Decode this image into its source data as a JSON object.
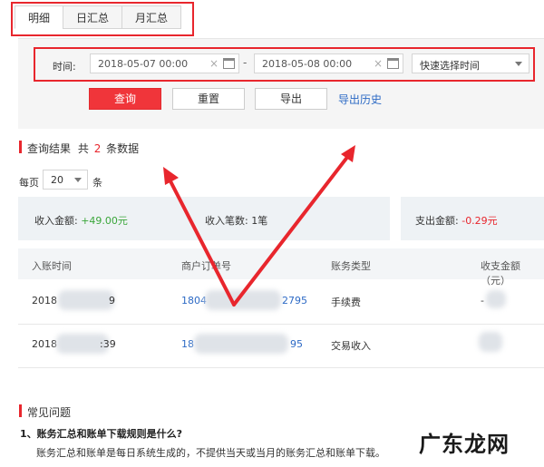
{
  "tabs": [
    "明细",
    "日汇总",
    "月汇总"
  ],
  "filter": {
    "time_label": "时间:",
    "start_date": "2018-05-07 00:00",
    "end_date": "2018-05-08 00:00",
    "range_separator": "-",
    "clear_symbol": "×",
    "quick_select": "快速选择时间"
  },
  "buttons": {
    "query": "查询",
    "reset": "重置",
    "export": "导出",
    "export_history": "导出历史"
  },
  "results": {
    "title": "查询结果",
    "prefix": "共",
    "count": "2",
    "suffix": "条数据"
  },
  "pagination": {
    "per_page_label": "每页",
    "per_page_value": "20",
    "per_page_unit": "条"
  },
  "summary": {
    "income_label": "收入金额:",
    "income_value": "+49.00元",
    "income_count_label": "收入笔数:",
    "income_count_value": "1笔",
    "expense_label": "支出金额:",
    "expense_value": "-0.29元"
  },
  "table": {
    "headers": [
      "入账时间",
      "商户订单号",
      "账务类型",
      "收支金额（元）"
    ],
    "rows": [
      {
        "time": "2018",
        "time_tail": "9",
        "order": "1804",
        "order_tail": "2795",
        "type": "手续费",
        "amount": "-"
      },
      {
        "time": "2018",
        "time_tail": ":39",
        "order": "18",
        "order_tail": "95",
        "type": "交易收入",
        "amount": ""
      }
    ]
  },
  "faq": {
    "title": "常见问题",
    "q1": "1、账务汇总和账单下载规则是什么?",
    "a1": "账务汇总和账单是每日系统生成的，不提供当天或当月的账务汇总和账单下载。"
  },
  "watermark": "广东龙网",
  "colors": {
    "accent_red": "#e8262d",
    "link_blue": "#2d6ac5",
    "positive_green": "#3aa63a"
  }
}
